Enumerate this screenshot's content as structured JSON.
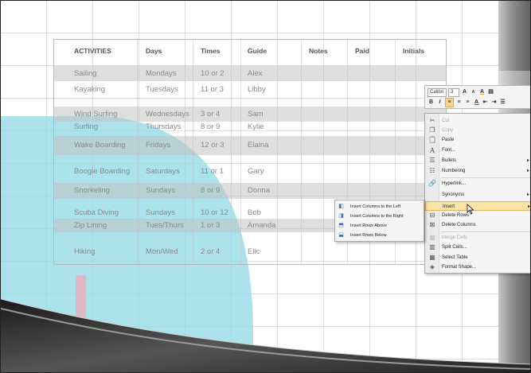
{
  "table": {
    "headers": [
      "ACTIVITIES",
      "Days",
      "Times",
      "Guide",
      "Notes",
      "Paid",
      "Initials"
    ],
    "rows": [
      [
        "Sailing",
        "Mondays",
        "10 or 2",
        "Alex"
      ],
      [
        "Kayaking",
        "Tuesdays",
        "11 or 3",
        "Libby"
      ],
      [
        "Wind Surfing",
        "Wednesdays",
        "3 or 4",
        "Sam"
      ],
      [
        "Surfing",
        "Thursdays",
        "8 or 9",
        "Kylie"
      ],
      [
        "Wake Boarding",
        "Fridays",
        "12 or 3",
        "Elaina"
      ],
      [
        "Boogie Boarding",
        "Saturdays",
        "11 or 1",
        "Gary"
      ],
      [
        "Snorkeling",
        "Sundays",
        "8 or 9",
        "Donna"
      ],
      [
        "Scuba Diving",
        "Sundays",
        "10 or 12",
        "Bob"
      ],
      [
        "Zip Lining",
        "Tues/Thurs",
        "1 or 3",
        "Amanda"
      ],
      [
        "Hiking",
        "Mon/Wed",
        "2 or 4",
        "Elic"
      ]
    ]
  },
  "mini_toolbar": {
    "font_name": "Calibri",
    "font_size": "3",
    "row1_symbols": [
      "A",
      "A",
      "A"
    ],
    "row2_symbols": [
      "B",
      "I",
      "A"
    ]
  },
  "context_menu": {
    "items": [
      {
        "label": "Cut",
        "icon": "scissors-icon",
        "disabled": true
      },
      {
        "label": "Copy",
        "icon": "copy-icon",
        "disabled": true
      },
      {
        "label": "Paste",
        "icon": "paste-icon",
        "disabled": false
      },
      {
        "label": "Font...",
        "icon": "font-icon",
        "disabled": false
      },
      {
        "label": "Bullets",
        "icon": "bullets-icon",
        "disabled": false,
        "submenu": true
      },
      {
        "label": "Numbering",
        "icon": "numbering-icon",
        "disabled": false,
        "submenu": true
      },
      {
        "label": "Hyperlink...",
        "icon": "hyperlink-icon",
        "disabled": false
      },
      {
        "label": "Synonyms",
        "icon": "",
        "disabled": false,
        "submenu": true
      },
      {
        "label": "Insert",
        "icon": "",
        "disabled": false,
        "submenu": true,
        "highlighted": true
      },
      {
        "label": "Delete Rows",
        "icon": "delete-rows-icon",
        "disabled": false
      },
      {
        "label": "Delete Columns",
        "icon": "delete-columns-icon",
        "disabled": false
      },
      {
        "label": "Merge Cells",
        "icon": "merge-cells-icon",
        "disabled": true
      },
      {
        "label": "Split Cells...",
        "icon": "split-cells-icon",
        "disabled": false
      },
      {
        "label": "Select Table",
        "icon": "select-table-icon",
        "disabled": false
      },
      {
        "label": "Format Shape...",
        "icon": "format-shape-icon",
        "disabled": false
      }
    ]
  },
  "insert_submenu": {
    "items": [
      {
        "label": "Insert Columns to the Left",
        "icon": "insert-columns-left-icon"
      },
      {
        "label": "Insert Columns to the Right",
        "icon": "insert-columns-right-icon"
      },
      {
        "label": "Insert Rows Above",
        "icon": "insert-rows-above-icon"
      },
      {
        "label": "Insert Rows Below",
        "icon": "insert-rows-below-icon"
      }
    ]
  },
  "colors": {
    "menu_highlight": "#fbe3a6",
    "cyan_overlay": "#8fd8e6",
    "pink_overlay": "#f0aab5"
  }
}
